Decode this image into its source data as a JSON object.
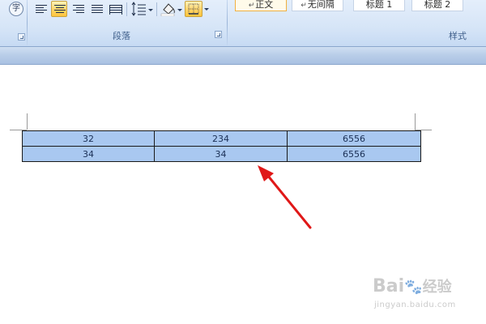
{
  "ribbon": {
    "paragraph_group_label": "段落",
    "styles_group_label": "样式",
    "styles": [
      {
        "label": "正文",
        "selected": true
      },
      {
        "label": "无间隔",
        "selected": false
      },
      {
        "label": "标题 1",
        "selected": false
      },
      {
        "label": "标题 2",
        "selected": false
      }
    ],
    "buttons": [
      "phonetic-guide-icon",
      "align-left-icon",
      "align-center-icon",
      "align-right-icon",
      "justify-icon",
      "distributed-icon",
      "line-spacing-icon",
      "shading-icon",
      "borders-icon"
    ],
    "accent_color": "#ffd468"
  },
  "table": {
    "rows": [
      [
        "32",
        "234",
        "6556"
      ],
      [
        "34",
        "34",
        "6556"
      ]
    ],
    "cell_fill": "#a9c8f0"
  },
  "annotation": {
    "arrow_color": "#e01818"
  },
  "watermark": {
    "brand": "Bai",
    "brand_cn": "经验",
    "url": "jingyan.baidu.com"
  }
}
